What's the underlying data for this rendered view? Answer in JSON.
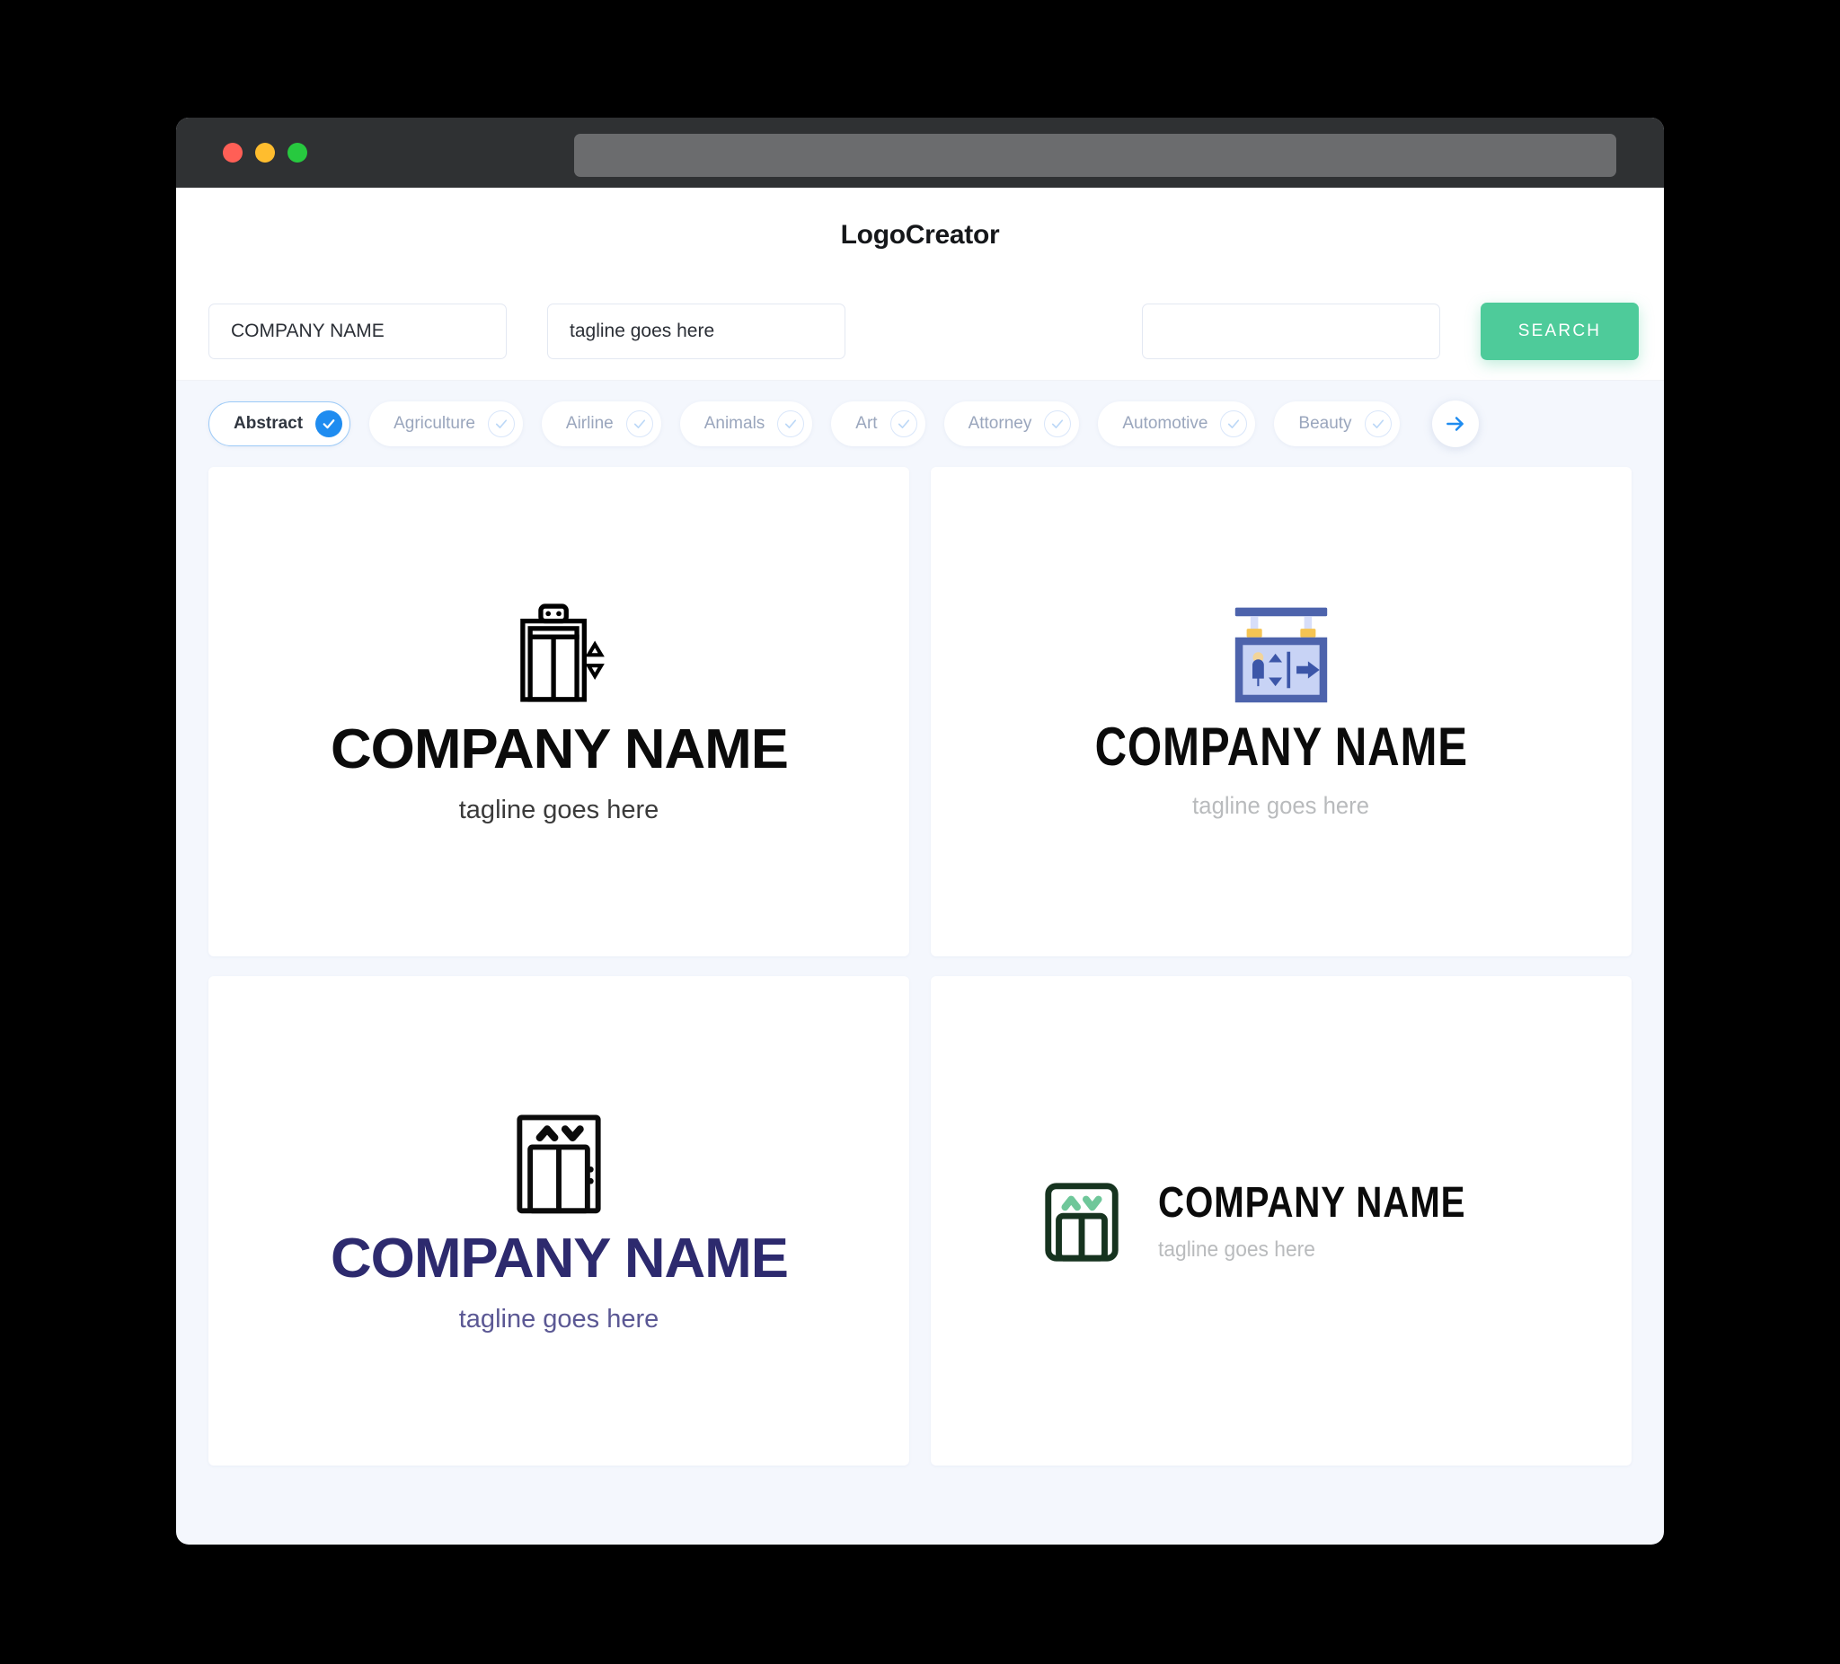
{
  "window": {
    "traffic_lights": [
      "close",
      "minimize",
      "maximize"
    ],
    "url_value": ""
  },
  "header": {
    "brand": "LogoCreator"
  },
  "search": {
    "company_value": "COMPANY NAME",
    "company_placeholder": "COMPANY NAME",
    "tagline_value": "tagline goes here",
    "tagline_placeholder": "tagline goes here",
    "extra_value": "",
    "extra_placeholder": "",
    "button_label": "SEARCH",
    "button_color": "#4ecb9a"
  },
  "categories": {
    "selected": "Abstract",
    "accent_color": "#1f8cf0",
    "next_icon": "arrow-right-icon",
    "items": [
      {
        "label": "Abstract",
        "selected": true
      },
      {
        "label": "Agriculture",
        "selected": false
      },
      {
        "label": "Airline",
        "selected": false
      },
      {
        "label": "Animals",
        "selected": false
      },
      {
        "label": "Art",
        "selected": false
      },
      {
        "label": "Attorney",
        "selected": false
      },
      {
        "label": "Automotive",
        "selected": false
      },
      {
        "label": "Beauty",
        "selected": false
      }
    ]
  },
  "results": [
    {
      "icon": "elevator-outline-icon",
      "company": "COMPANY NAME",
      "tagline": "tagline goes here",
      "name_color": "#0b0b0b",
      "tagline_color": "#3a3a3a",
      "layout": "vertical"
    },
    {
      "icon": "elevator-hanging-sign-icon",
      "company": "COMPANY NAME",
      "tagline": "tagline goes here",
      "name_color": "#0b0b0b",
      "tagline_color": "#b9bbbd",
      "layout": "vertical"
    },
    {
      "icon": "elevator-chevrons-icon",
      "company": "COMPANY NAME",
      "tagline": "tagline goes here",
      "name_color": "#2d2a6e",
      "tagline_color": "#5b5894",
      "layout": "vertical"
    },
    {
      "icon": "elevator-green-icon",
      "company": "COMPANY NAME",
      "tagline": "tagline goes here",
      "name_color": "#0b0b0b",
      "tagline_color": "#b9bbbd",
      "layout": "horizontal"
    }
  ]
}
